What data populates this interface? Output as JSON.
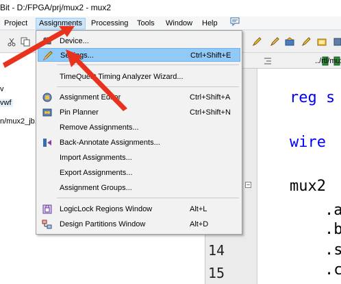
{
  "window": {
    "title": "Bit - D:/FPGA/prj/mux2 - mux2"
  },
  "menubar": {
    "items": [
      "Project",
      "Assignments",
      "Processing",
      "Tools",
      "Window",
      "Help"
    ],
    "active": "Assignments"
  },
  "left_panel": {
    "lines": [
      "v",
      "vwf",
      "n/mux2_jb."
    ]
  },
  "editor": {
    "path": "../rtl/mux",
    "line_numbers": [
      "14",
      "15"
    ],
    "code": [
      "reg s",
      "wire",
      "mux2",
      ".a",
      ".b",
      ".s",
      ".c"
    ]
  },
  "assignments_menu": {
    "items": [
      {
        "label": "Device...",
        "shortcut": "",
        "icon": "device-chip-icon"
      },
      {
        "label": "Settings...",
        "shortcut": "Ctrl+Shift+E",
        "icon": "settings-pencil-icon",
        "highlighted": true
      },
      {
        "label": "TimeQuest Timing Analyzer Wizard...",
        "shortcut": ""
      },
      {
        "label": "Assignment Editor",
        "shortcut": "Ctrl+Shift+A",
        "icon": "assignment-editor-icon"
      },
      {
        "label": "Pin Planner",
        "shortcut": "Ctrl+Shift+N",
        "icon": "pin-planner-icon"
      },
      {
        "label": "Remove Assignments...",
        "shortcut": ""
      },
      {
        "label": "Back-Annotate Assignments...",
        "shortcut": "",
        "icon": "back-annotate-icon"
      },
      {
        "label": "Import Assignments...",
        "shortcut": ""
      },
      {
        "label": "Export Assignments...",
        "shortcut": ""
      },
      {
        "label": "Assignment Groups...",
        "shortcut": ""
      },
      {
        "label": "LogicLock Regions Window",
        "shortcut": "Alt+L",
        "icon": "logiclock-icon"
      },
      {
        "label": "Design Partitions Window",
        "shortcut": "Alt+D",
        "icon": "design-partitions-icon"
      }
    ]
  },
  "colors": {
    "highlight": "#91c9f7",
    "keyword": "#0000ff",
    "arrow": "#e8321e"
  }
}
